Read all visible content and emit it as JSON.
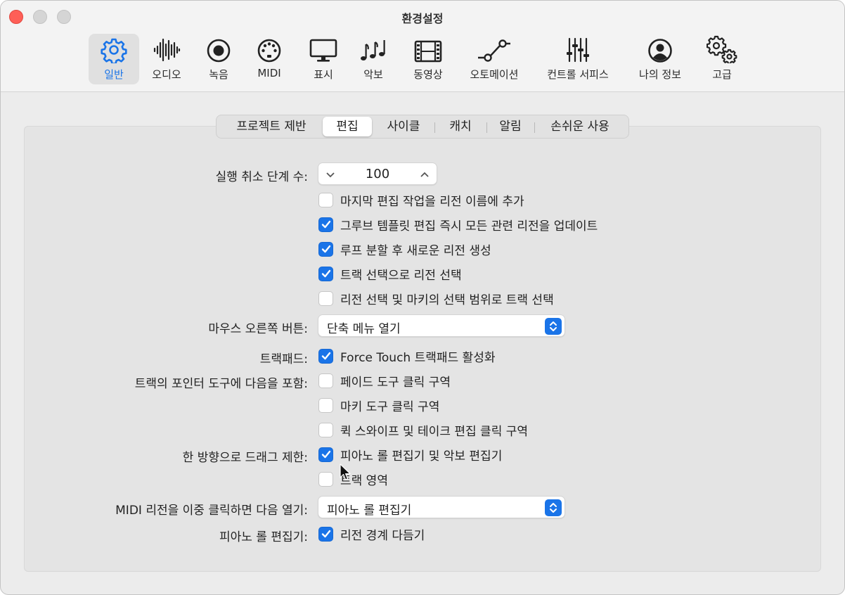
{
  "window": {
    "title": "환경설정"
  },
  "toolbar": {
    "items": [
      {
        "label": "일반",
        "icon": "gear-icon",
        "active": true
      },
      {
        "label": "오디오",
        "icon": "waveform-icon"
      },
      {
        "label": "녹음",
        "icon": "record-icon"
      },
      {
        "label": "MIDI",
        "icon": "midi-port-icon"
      },
      {
        "label": "표시",
        "icon": "display-icon"
      },
      {
        "label": "악보",
        "icon": "music-notes-icon"
      },
      {
        "label": "동영상",
        "icon": "film-icon"
      },
      {
        "label": "오토메이션",
        "icon": "automation-curve-icon"
      },
      {
        "label": "컨트롤 서피스",
        "icon": "sliders-icon"
      },
      {
        "label": "나의 정보",
        "icon": "person-icon"
      },
      {
        "label": "고급",
        "icon": "gears-icon"
      }
    ]
  },
  "tabs": {
    "items": [
      "프로젝트 제반",
      "편집",
      "사이클",
      "캐치",
      "알림",
      "손쉬운 사용"
    ],
    "selected": "편집"
  },
  "accent_color": "#1a74e8",
  "settings": {
    "undo_steps": {
      "label": "실행 취소 단계 수:",
      "value": "100"
    },
    "checks_group1": [
      {
        "text": "마지막 편집 작업을 리전 이름에 추가",
        "checked": false
      },
      {
        "text": "그루브 템플릿 편집 즉시 모든 관련 리전을 업데이트",
        "checked": true
      },
      {
        "text": "루프 분할 후 새로운 리전 생성",
        "checked": true
      },
      {
        "text": "트랙 선택으로 리전 선택",
        "checked": true
      },
      {
        "text": "리전 선택 및 마키의 선택 범위로 트랙 선택",
        "checked": false
      }
    ],
    "right_mouse": {
      "label": "마우스 오른쪽 버튼:",
      "value": "단축 메뉴 열기"
    },
    "trackpad": {
      "label": "트랙패드:",
      "text": "Force Touch 트랙패드 활성화",
      "checked": true
    },
    "pointer_tool": {
      "label": "트랙의 포인터 도구에 다음을 포함:",
      "options": [
        {
          "text": "페이드 도구 클릭 구역",
          "checked": false
        },
        {
          "text": "마키 도구 클릭 구역",
          "checked": false
        },
        {
          "text": "퀵 스와이프 및 테이크 편집 클릭 구역",
          "checked": false
        }
      ]
    },
    "drag_limit": {
      "label": "한 방향으로 드래그 제한:",
      "options": [
        {
          "text": "피아노 롤 편집기 및 악보 편집기",
          "checked": true
        },
        {
          "text": "트랙 영역",
          "checked": false
        }
      ]
    },
    "midi_double_click": {
      "label": "MIDI 리전을 이중 클릭하면 다음 열기:",
      "value": "피아노 롤 편집기"
    },
    "piano_roll": {
      "label": "피아노 롤 편집기:",
      "text": "리전 경계 다듬기",
      "checked": true
    }
  }
}
